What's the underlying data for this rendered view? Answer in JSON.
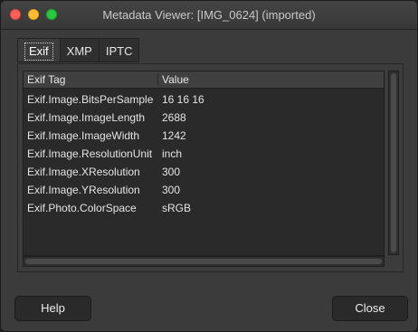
{
  "window": {
    "title": "Metadata Viewer: [IMG_0624] (imported)"
  },
  "tabs": [
    {
      "label": "Exif",
      "active": true
    },
    {
      "label": "XMP",
      "active": false
    },
    {
      "label": "IPTC",
      "active": false
    }
  ],
  "table": {
    "columns": [
      "Exif Tag",
      "Value"
    ],
    "rows": [
      {
        "tag": "Exif.Image.BitsPerSample",
        "value": "16 16 16"
      },
      {
        "tag": "Exif.Image.ImageLength",
        "value": "2688"
      },
      {
        "tag": "Exif.Image.ImageWidth",
        "value": "1242"
      },
      {
        "tag": "Exif.Image.ResolutionUnit",
        "value": "inch"
      },
      {
        "tag": "Exif.Image.XResolution",
        "value": "300"
      },
      {
        "tag": "Exif.Image.YResolution",
        "value": "300"
      },
      {
        "tag": "Exif.Photo.ColorSpace",
        "value": "sRGB"
      }
    ]
  },
  "buttons": {
    "help": "Help",
    "close": "Close"
  },
  "colors": {
    "window_background": "#3b3b3b",
    "table_background": "#2a2a2a",
    "text": "#e4e4e4",
    "traffic_close": "#fe5f57",
    "traffic_minimize": "#febc2e",
    "traffic_maximize": "#28c840"
  }
}
